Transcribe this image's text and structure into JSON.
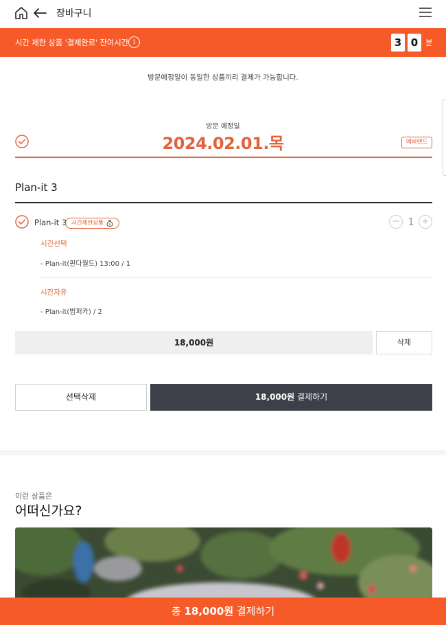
{
  "header": {
    "title": "장바구니",
    "home_icon": "home-icon",
    "back_icon": "arrow-left-icon",
    "menu_icon": "hamburger-menu-icon"
  },
  "timer": {
    "text": "시간 제한 상품 '결제완료' 잔여시간",
    "digit1": "3",
    "digit2": "0",
    "unit": "분",
    "info_icon": "info-icon"
  },
  "notice": "방문예정일이 동일한 상품끼리 결제가 가능합니다.",
  "visit": {
    "label": "방문 예정일",
    "date": "2024.02.01.목",
    "place": "에버랜드"
  },
  "section": {
    "title": "Plan-it 3"
  },
  "item": {
    "name": "Plan-it 3",
    "badge": "시간제한상품",
    "quantity": "1",
    "minus": "−",
    "plus": "+",
    "options": [
      {
        "label": "시간선택",
        "value": "- Plan-it(판다월드) 13:00 / 1"
      },
      {
        "label": "시간자유",
        "value": "- Plan-it(범퍼카) / 2"
      }
    ],
    "price": "18,000원",
    "delete_label": "삭제"
  },
  "actions": {
    "select_delete": "선택삭제",
    "checkout_amount": "18,000원",
    "checkout_label": "결제하기"
  },
  "recommend": {
    "subtitle": "이런 상품은",
    "title": "어떠신가요?"
  },
  "bottom_bar": {
    "prefix": "총",
    "amount": "18,000원",
    "label": "결제하기"
  },
  "colors": {
    "accent": "#f55a28",
    "brand_text": "#e2623b",
    "dark_button": "#3d4048"
  }
}
